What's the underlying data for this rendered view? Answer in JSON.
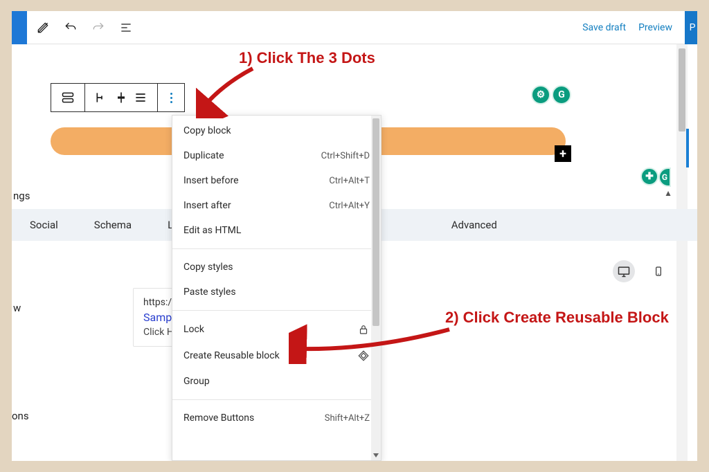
{
  "header": {
    "save_draft": "Save draft",
    "preview": "Preview",
    "publish": "P"
  },
  "toolbar": {
    "transform": "transform",
    "align_left": "align-left",
    "align_center": "align-center",
    "align_full": "align-full",
    "more": "more"
  },
  "annotations": {
    "step1": "1) Click The 3 Dots",
    "step2": "2) Click Create Reusable Block"
  },
  "menu": {
    "copy_block": "Copy block",
    "duplicate": "Duplicate",
    "duplicate_sc": "Ctrl+Shift+D",
    "insert_before": "Insert before",
    "insert_before_sc": "Ctrl+Alt+T",
    "insert_after": "Insert after",
    "insert_after_sc": "Ctrl+Alt+Y",
    "edit_html": "Edit as HTML",
    "copy_styles": "Copy styles",
    "paste_styles": "Paste styles",
    "lock": "Lock",
    "create_reusable": "Create Reusable block",
    "group": "Group",
    "remove": "Remove Buttons",
    "remove_sc": "Shift+Alt+Z"
  },
  "bottom": {
    "panel_label": "ngs",
    "tabs": {
      "social": "Social",
      "schema": "Schema",
      "link": "Link",
      "advanced": "Advanced"
    },
    "left_w": "w",
    "left_ons": "ons"
  },
  "card": {
    "url": "https:/",
    "title": "Samp",
    "desc": "Click H"
  },
  "badges": {
    "left1": "⚙",
    "left2": "G",
    "right1": "✚",
    "right2": "G"
  }
}
